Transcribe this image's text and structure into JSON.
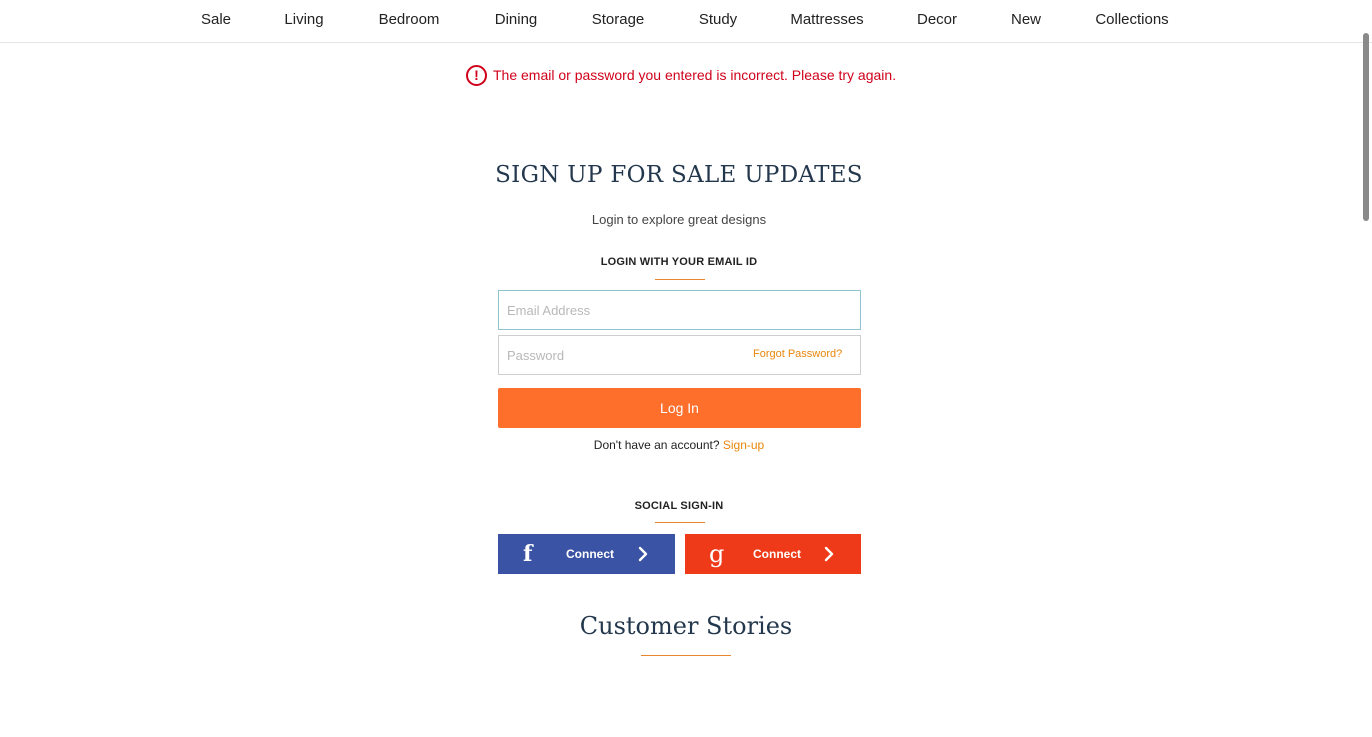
{
  "nav": {
    "items": [
      "Sale",
      "Living",
      "Bedroom",
      "Dining",
      "Storage",
      "Study",
      "Mattresses",
      "Decor",
      "New",
      "Collections"
    ]
  },
  "error": {
    "icon": "exclamation-circle-icon",
    "message": "The email or password you entered is incorrect. Please try again.",
    "color": "#d0021b"
  },
  "login": {
    "title": "SIGN UP FOR SALE UPDATES",
    "subtitle": "Login to explore great designs",
    "email_section_label": "LOGIN WITH YOUR EMAIL ID",
    "email_placeholder": "Email Address",
    "email_value": "",
    "password_placeholder": "Password",
    "password_value": "",
    "forgot_label": "Forgot Password?",
    "login_button": "Log In",
    "no_account_text": "Don't have an account?",
    "signup_link": "Sign-up",
    "accent_color": "#ff6f2c"
  },
  "social": {
    "section_label": "SOCIAL SIGN-IN",
    "facebook": {
      "logo": "f",
      "label": "Connect",
      "icon": "facebook-icon",
      "color": "#3b53a4"
    },
    "google": {
      "logo": "g",
      "label": "Connect",
      "icon": "google-icon",
      "color": "#ee3a18"
    }
  },
  "stories": {
    "title": "Customer Stories"
  }
}
